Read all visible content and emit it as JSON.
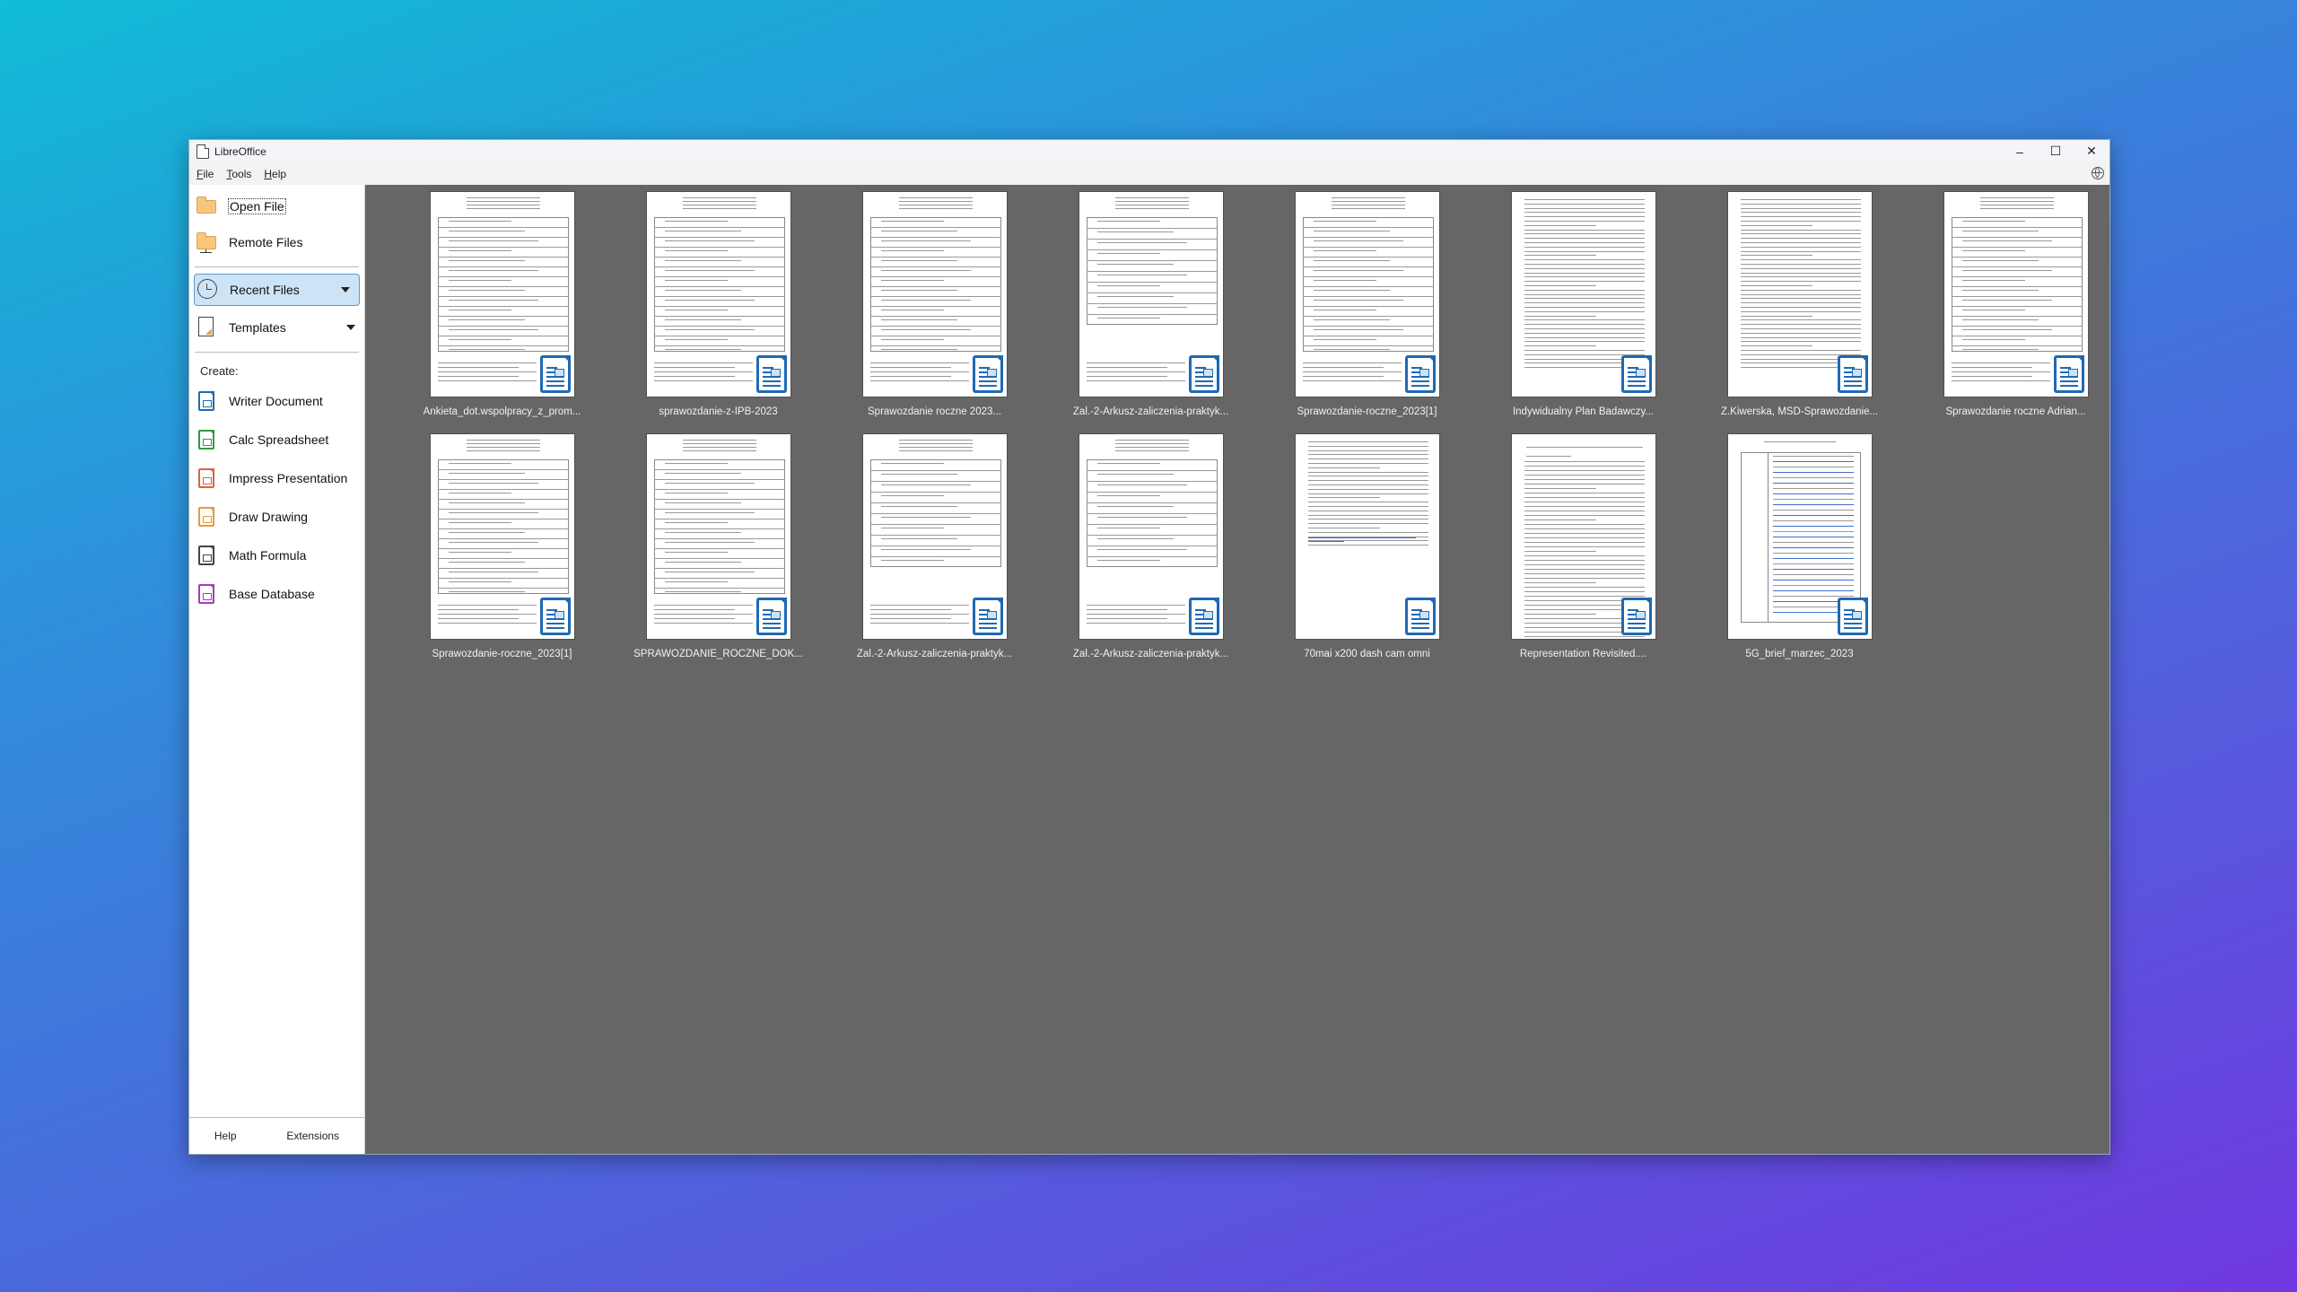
{
  "window": {
    "title": "LibreOffice",
    "controls": {
      "minimize": "–",
      "maximize": "☐",
      "close": "✕"
    }
  },
  "menubar": {
    "items": [
      {
        "label": "File",
        "mnemonic": "F",
        "rest": "ile"
      },
      {
        "label": "Tools",
        "mnemonic": "T",
        "rest": "ools"
      },
      {
        "label": "Help",
        "mnemonic": "H",
        "rest": "elp"
      }
    ],
    "update_icon": "globe-update-icon"
  },
  "sidebar": {
    "open_file": "Open File",
    "remote_files": "Remote Files",
    "recent_files": "Recent Files",
    "templates": "Templates",
    "create_label": "Create:",
    "create_items": [
      {
        "label": "Writer Document",
        "icon": "writer-icon",
        "color": "#1f69b3"
      },
      {
        "label": "Calc Spreadsheet",
        "icon": "calc-icon",
        "color": "#2e9a4a"
      },
      {
        "label": "Impress Presentation",
        "icon": "impress-icon",
        "color": "#d9663f"
      },
      {
        "label": "Draw Drawing",
        "icon": "draw-icon",
        "color": "#e9993a"
      },
      {
        "label": "Math Formula",
        "icon": "math-icon",
        "color": "#444444"
      },
      {
        "label": "Base Database",
        "icon": "base-icon",
        "color": "#a33fb8"
      }
    ],
    "footer": {
      "help": "Help",
      "extensions": "Extensions"
    }
  },
  "recent_files": [
    {
      "name": "Ankieta_dot.wspolpracy_z_prom...",
      "type": "writer",
      "style": "form"
    },
    {
      "name": "sprawozdanie-z-IPB-2023",
      "type": "writer",
      "style": "form"
    },
    {
      "name": "Sprawozdanie roczne 2023...",
      "type": "writer",
      "style": "form"
    },
    {
      "name": "Zal.-2-Arkusz-zaliczenia-praktyk...",
      "type": "writer",
      "style": "sheet"
    },
    {
      "name": "Sprawozdanie-roczne_2023[1]",
      "type": "writer",
      "style": "form"
    },
    {
      "name": "Indywidualny Plan Badawczy...",
      "type": "writer",
      "style": "text"
    },
    {
      "name": "Z.Kiwerska, MSD-Sprawozdanie...",
      "type": "writer",
      "style": "text"
    },
    {
      "name": "Sprawozdanie roczne Adrian...",
      "type": "writer",
      "style": "form"
    },
    {
      "name": "Sprawozdanie-roczne_2023[1]",
      "type": "writer",
      "style": "form"
    },
    {
      "name": "SPRAWOZDANIE_ROCZNE_DOK...",
      "type": "writer",
      "style": "form"
    },
    {
      "name": "Zal.-2-Arkusz-zaliczenia-praktyk...",
      "type": "writer",
      "style": "sheet"
    },
    {
      "name": "Zal.-2-Arkusz-zaliczenia-praktyk...",
      "type": "writer",
      "style": "sheet"
    },
    {
      "name": "70mai x200 dash cam omni",
      "type": "writer",
      "style": "short"
    },
    {
      "name": "Representation Revisited....",
      "type": "writer",
      "style": "essay"
    },
    {
      "name": "5G_brief_marzec_2023",
      "type": "writer",
      "style": "table"
    }
  ]
}
